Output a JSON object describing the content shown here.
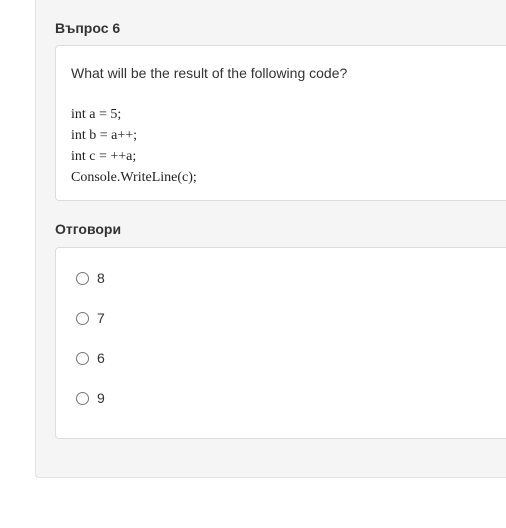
{
  "question": {
    "heading": "Въпрос 6",
    "text": "What will be the result of the following code?",
    "code_lines": [
      "int a = 5;",
      "int b = a++;",
      "int c = ++a;",
      "Console.WriteLine(c);"
    ]
  },
  "answers": {
    "heading": "Отговори",
    "options": [
      {
        "label": "8",
        "selected": false
      },
      {
        "label": "7",
        "selected": false
      },
      {
        "label": "6",
        "selected": false
      },
      {
        "label": "9",
        "selected": false
      }
    ]
  }
}
